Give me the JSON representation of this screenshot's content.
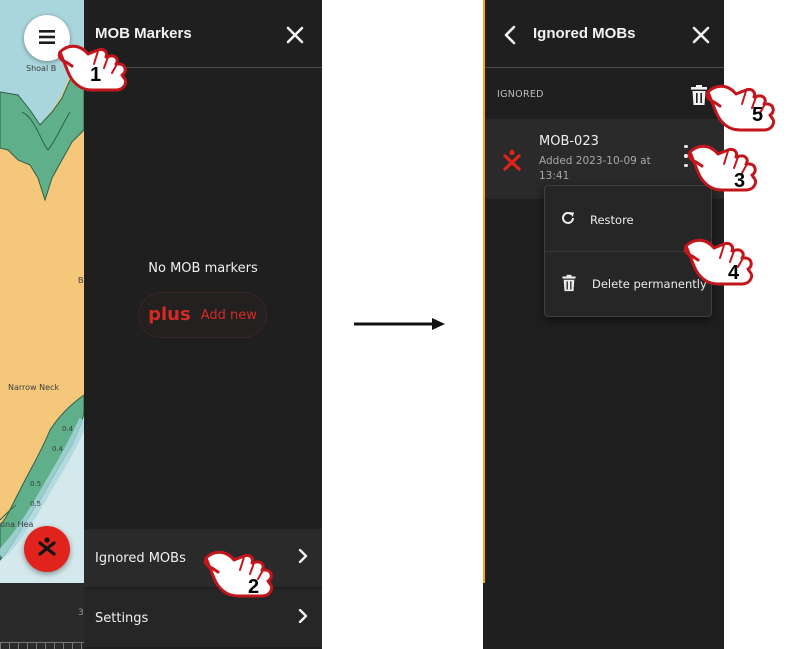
{
  "left_screen": {
    "map": {
      "place_labels": [
        "Shoal B",
        "Narrow Neck",
        "una Hea",
        "B"
      ],
      "depth_labels": [
        "0.4",
        "0.5",
        "0.5",
        "0.4"
      ],
      "scale_text": "3",
      "colors": {
        "land": "#f5c77a",
        "shallow_water": "#5fb08a",
        "water": "#a9d6dc",
        "deep_water": "#d4e9ed"
      }
    },
    "menu_button_icon": "hamburger-icon",
    "mob_button_icon": "mob-person-icon",
    "drawer": {
      "title": "MOB Markers",
      "close_icon": "close-icon",
      "empty_text": "No MOB markers",
      "add_new": {
        "icon": "plus",
        "label": "Add new"
      },
      "rows": [
        {
          "label": "Ignored MOBs",
          "icon": "chevron-right-icon"
        },
        {
          "label": "Settings",
          "icon": "chevron-right-icon"
        }
      ]
    }
  },
  "right_screen": {
    "title": "Ignored MOBs",
    "back_icon": "chevron-left-icon",
    "close_icon": "close-icon",
    "section_label": "IGNORED",
    "delete_all_icon": "trash-icon",
    "items": [
      {
        "name": "MOB-023",
        "meta": "Added 2023-10-09 at 13:41",
        "icon": "mob-person-icon"
      }
    ],
    "context_menu": [
      {
        "label": "Restore",
        "icon": "restore-icon"
      },
      {
        "label": "Delete permanently",
        "icon": "trash-icon"
      }
    ]
  },
  "steps": [
    "1",
    "2",
    "3",
    "4",
    "5"
  ],
  "colors": {
    "accent_red": "#e0241d",
    "panel_bg": "#1f1f1f",
    "row_bg": "#2a2a2a",
    "highlight_edge": "#f3a51c"
  }
}
